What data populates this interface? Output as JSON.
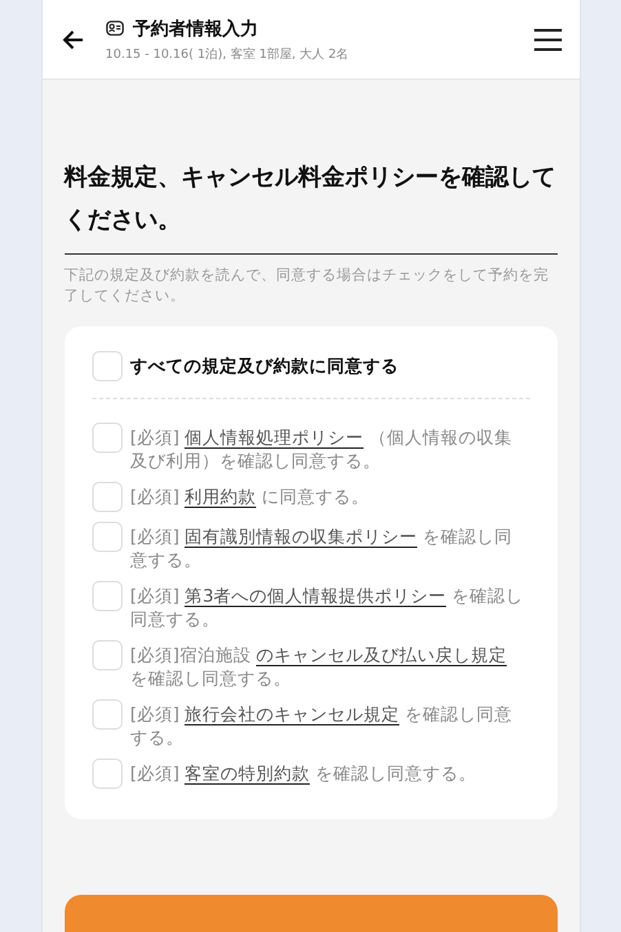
{
  "header": {
    "title": "予約者情報入力",
    "subtitle": "10.15 - 10.16( 1泊), 客室 1部屋, 大人 2名"
  },
  "heading": "料金規定、キャンセル料金ポリシーを確認してください。",
  "description": "下記の規定及び約款を読んで、同意する場合はチェックをして予約を完了してください。",
  "agree_all": {
    "label": "すべての規定及び約款に同意する",
    "checked": false
  },
  "terms": [
    {
      "prefix": "[必須] ",
      "link": "個人情報処理ポリシー",
      "suffix": " （個人情報の収集及び利用）を確認し同意する。",
      "checked": false
    },
    {
      "prefix": "[必須] ",
      "link": "利用約款",
      "suffix": " に同意する。",
      "checked": false
    },
    {
      "prefix": "[必須] ",
      "link": "固有識別情報の収集ポリシー",
      "suffix": " を確認し同意する。",
      "checked": false
    },
    {
      "prefix": "[必須] ",
      "link": "第3者への個人情報提供ポリシー",
      "suffix": " を確認し同意する。",
      "checked": false
    },
    {
      "prefix": "[必須]宿泊施設 ",
      "link": "のキャンセル及び払い戻し規定",
      "suffix": " を確認し同意する。",
      "checked": false
    },
    {
      "prefix": "[必須] ",
      "link": "旅行会社のキャンセル規定",
      "suffix": " を確認し同意する。",
      "checked": false
    },
    {
      "prefix": "[必須] ",
      "link": "客室の特別約款",
      "suffix": " を確認し同意する。",
      "checked": false
    }
  ]
}
